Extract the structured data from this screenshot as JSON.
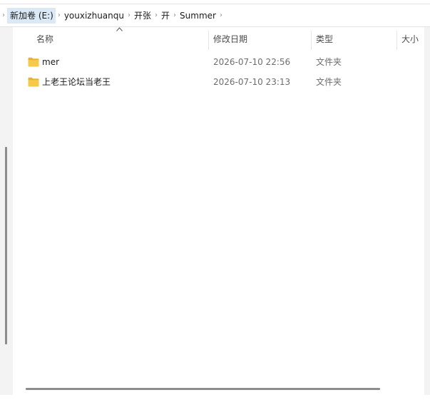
{
  "breadcrumb": {
    "items": [
      "新加卷 (E:)",
      "youxizhuanqu",
      "开张",
      "开",
      "Summer"
    ],
    "separator": "›"
  },
  "columns": {
    "name": "名称",
    "date": "修改日期",
    "type": "类型",
    "size": "大小",
    "sort_icon": "chevron-up"
  },
  "files": [
    {
      "name": "mer",
      "date": "2026-07-10 22:56",
      "type": "文件夹",
      "icon": "folder-icon"
    },
    {
      "name": "上老王论坛当老王",
      "date": "2026-07-10 23:13",
      "type": "文件夹",
      "icon": "folder-icon"
    }
  ],
  "colors": {
    "selected_crumb": "#dbe9f7",
    "folder": "#f7c948",
    "scrollbar": "#8d8d8d"
  }
}
